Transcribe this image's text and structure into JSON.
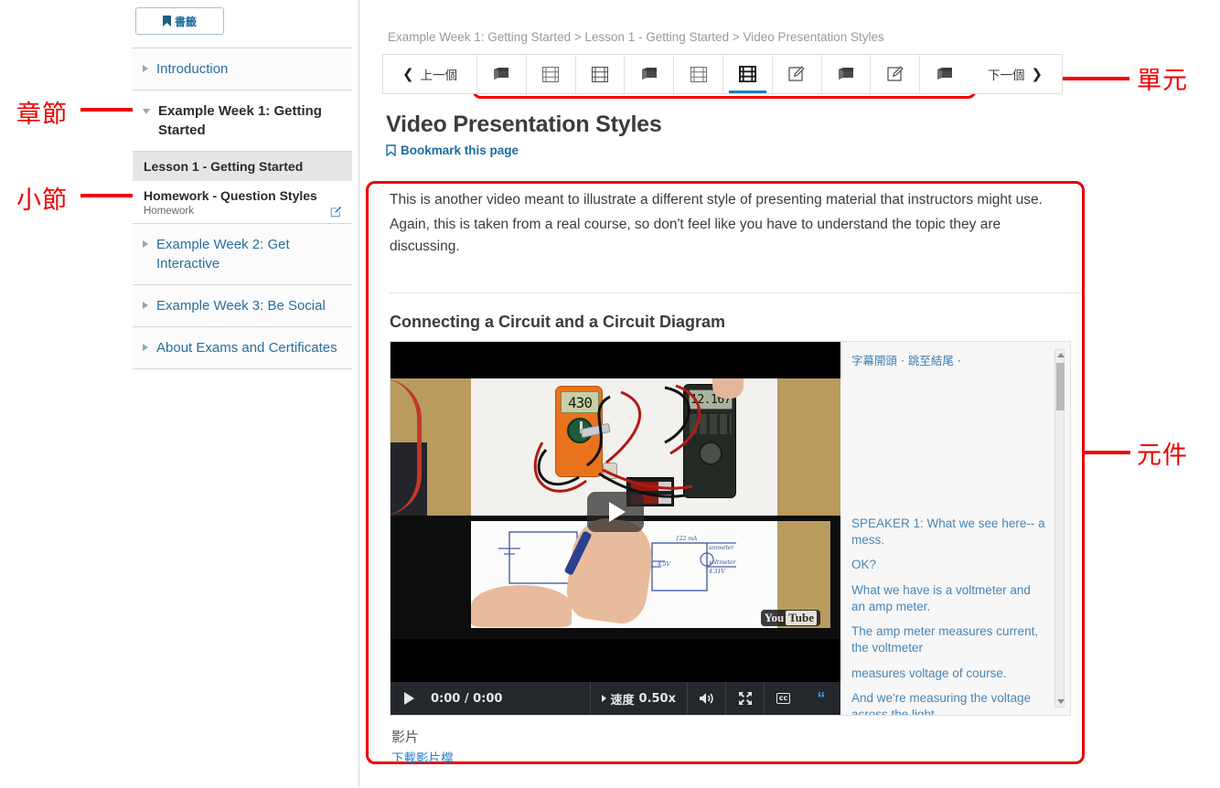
{
  "annotations": {
    "chapter": "章節",
    "section": "小節",
    "unit": "單元",
    "component": "元件"
  },
  "sidebar": {
    "bookmark_button": "書籤",
    "chapters": [
      {
        "title": "Introduction",
        "state": "collapsed"
      },
      {
        "title": "Example Week 1: Getting Started",
        "state": "expanded"
      },
      {
        "title": "Example Week 2: Get Interactive",
        "state": "collapsed"
      },
      {
        "title": "Example Week 3: Be Social",
        "state": "collapsed"
      },
      {
        "title": "About Exams and Certificates",
        "state": "collapsed"
      }
    ],
    "sections": [
      {
        "name": "Lesson 1 - Getting Started",
        "sub": "",
        "current": true
      },
      {
        "name": "Homework - Question Styles",
        "sub": "Homework",
        "current": false
      }
    ]
  },
  "main": {
    "breadcrumb": "Example Week 1: Getting Started > Lesson 1 - Getting Started > Video Presentation Styles",
    "nav": {
      "prev_label": "上一個",
      "next_label": "下一個",
      "units": [
        {
          "type": "book",
          "active": false
        },
        {
          "type": "video",
          "active": false
        },
        {
          "type": "video",
          "active": false
        },
        {
          "type": "book",
          "active": false
        },
        {
          "type": "video",
          "active": false
        },
        {
          "type": "video",
          "active": true
        },
        {
          "type": "problem",
          "active": false
        },
        {
          "type": "book",
          "active": false
        },
        {
          "type": "problem",
          "active": false
        },
        {
          "type": "book",
          "active": false
        }
      ]
    },
    "page_title": "Video Presentation Styles",
    "bookmark_page": "Bookmark this page",
    "paragraphs": [
      "This is another video meant to illustrate a different style of presenting material that instructors might use.",
      "Again, this is taken from a real course, so don't feel like you have to understand the topic they are discussing."
    ],
    "video_heading": "Connecting a Circuit and a Circuit Diagram",
    "player": {
      "time": "0:00 / 0:00",
      "speed_label": "速度",
      "speed_value": "0.50x",
      "cc_label": "cc",
      "meter_left_reading": "430",
      "meter_right_reading": "12.167",
      "youtube_you": "You",
      "youtube_tube": "Tube",
      "diagram_labels": [
        "122 mA",
        "ammeter",
        "voltmeter",
        "4.31V",
        "4.5V"
      ]
    },
    "transcript": {
      "header": "字幕開頭 · 跳至結尾 ·",
      "lines": [
        "SPEAKER 1: What we see here-- a mess.",
        "OK?",
        "What we have is a voltmeter and an amp meter.",
        "The amp meter measures current, the voltmeter",
        "measures voltage of course.",
        "And we're measuring the voltage across the light"
      ]
    },
    "download": {
      "title": "影片",
      "link": "下載影片檔"
    }
  },
  "colors": {
    "accent_blue": "#2a7fc0",
    "link_blue": "#1c6ca1",
    "annotation_red": "#ee0000",
    "active_underline": "#1c7cc0"
  }
}
